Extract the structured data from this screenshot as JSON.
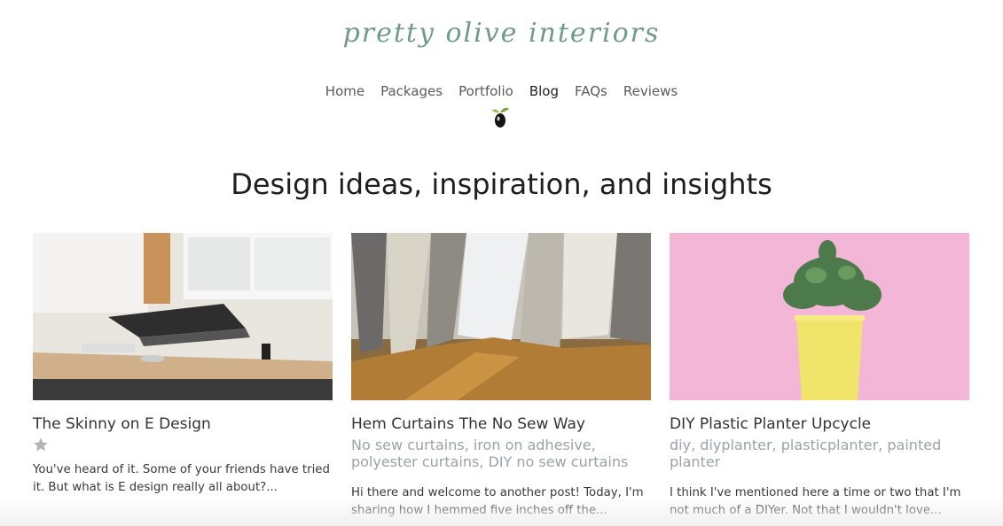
{
  "brand": {
    "logo_text": "pretty olive interiors"
  },
  "nav": {
    "items": [
      {
        "label": "Home"
      },
      {
        "label": "Packages"
      },
      {
        "label": "Portfolio"
      },
      {
        "label": "Blog",
        "active": true
      },
      {
        "label": "FAQs"
      },
      {
        "label": "Reviews"
      }
    ]
  },
  "page": {
    "heading": "Design ideas, inspiration, and insights"
  },
  "posts": [
    {
      "title": "The Skinny on E Design",
      "tags": "",
      "has_star": true,
      "excerpt": "You've heard of it. Some of your friends have tried it. But what is E design really all about?..."
    },
    {
      "title": "Hem Curtains The No Sew Way",
      "tags": "No sew curtains, iron on adhesive, polyester curtains, DIY no sew curtains",
      "has_star": false,
      "excerpt": "Hi there and welcome to another post! Today, I'm sharing how I hemmed five inches off the..."
    },
    {
      "title": "DIY Plastic Planter Upcycle",
      "tags": "diy, diyplanter, plasticplanter, painted planter",
      "has_star": false,
      "excerpt": "I think I've mentioned here a time or two that I'm not much of a DIYer. Not that I wouldn't love..."
    }
  ],
  "colors": {
    "logo": "#6f9a8c",
    "tags": "#9aa3a8",
    "planter": "#f0e56a",
    "pink_bg": "#f3b6d6"
  }
}
